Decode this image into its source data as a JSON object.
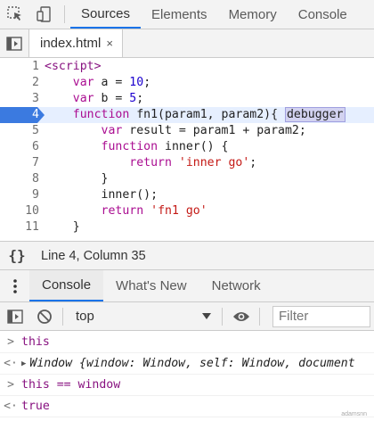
{
  "top_tabs": [
    "Sources",
    "Elements",
    "Memory",
    "Console"
  ],
  "active_top_tab": "Sources",
  "file_tab": {
    "name": "index.html",
    "close": "×"
  },
  "code_lines": [
    {
      "n": "1",
      "parts": [
        [
          "tag",
          "<script>"
        ]
      ]
    },
    {
      "n": "2",
      "parts": [
        [
          "",
          "    "
        ],
        [
          "kw",
          "var"
        ],
        [
          "",
          " a = "
        ],
        [
          "num",
          "10"
        ],
        [
          "",
          ";"
        ]
      ]
    },
    {
      "n": "3",
      "parts": [
        [
          "",
          "    "
        ],
        [
          "kw",
          "var"
        ],
        [
          "",
          " b = "
        ],
        [
          "num",
          "5"
        ],
        [
          "",
          ";"
        ]
      ]
    },
    {
      "n": "4",
      "current": true,
      "parts": [
        [
          "",
          "    "
        ],
        [
          "kw",
          "function"
        ],
        [
          "",
          " fn1(param1, param2){ "
        ],
        [
          "dbg",
          "debugger"
        ]
      ]
    },
    {
      "n": "5",
      "parts": [
        [
          "",
          "        "
        ],
        [
          "kw",
          "var"
        ],
        [
          "",
          " result = param1 + param2;"
        ]
      ]
    },
    {
      "n": "6",
      "parts": [
        [
          "",
          "        "
        ],
        [
          "kw",
          "function"
        ],
        [
          "",
          " inner() {"
        ]
      ]
    },
    {
      "n": "7",
      "parts": [
        [
          "",
          "            "
        ],
        [
          "kw",
          "return"
        ],
        [
          "",
          " "
        ],
        [
          "str",
          "'inner go'"
        ],
        [
          "",
          ";"
        ]
      ]
    },
    {
      "n": "8",
      "parts": [
        [
          "",
          "        }"
        ]
      ]
    },
    {
      "n": "9",
      "parts": [
        [
          "",
          "        inner();"
        ]
      ]
    },
    {
      "n": "10",
      "parts": [
        [
          "",
          "        "
        ],
        [
          "kw",
          "return"
        ],
        [
          "",
          " "
        ],
        [
          "str",
          "'fn1 go'"
        ]
      ]
    },
    {
      "n": "11",
      "parts": [
        [
          "",
          "    }"
        ]
      ]
    }
  ],
  "status": {
    "braces": "{}",
    "position": "Line 4, Column 35"
  },
  "drawer_tabs": [
    "Console",
    "What's New",
    "Network"
  ],
  "active_drawer_tab": "Console",
  "console_toolbar": {
    "context": "top",
    "filter_placeholder": "Filter"
  },
  "console_messages": [
    {
      "type": "input",
      "prompt": ">",
      "text": "this"
    },
    {
      "type": "output",
      "prompt": "<·",
      "text": "Window {window: Window, self: Window, document"
    },
    {
      "type": "input",
      "prompt": ">",
      "text": "this == window"
    },
    {
      "type": "result",
      "prompt": "<·",
      "text": "true"
    }
  ],
  "colors": {
    "accent": "#1a73e8",
    "keyword": "#aa0d91",
    "string": "#c41a16",
    "number": "#1c00cf",
    "current_line": "#e6efff",
    "breakpoint": "#3b7ae0"
  },
  "watermark": "adamsnn"
}
